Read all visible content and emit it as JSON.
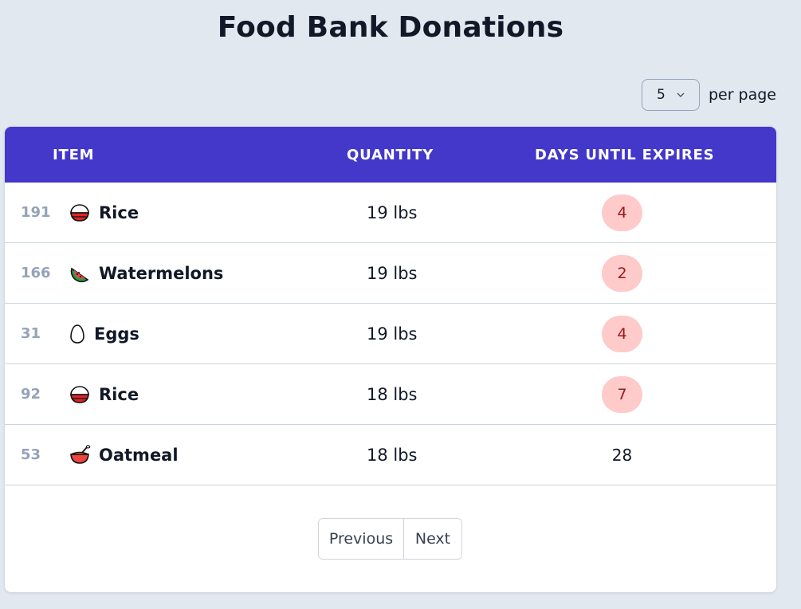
{
  "header": {
    "title": "Food Bank Donations"
  },
  "per_page": {
    "selected": "5",
    "label": "per page"
  },
  "table": {
    "columns": {
      "item": "ITEM",
      "quantity": "QUANTITY",
      "days": "DAYS UNTIL EXPIRES"
    },
    "rows": [
      {
        "id": "191",
        "icon": "rice-bowl-icon",
        "name": "Rice",
        "quantity": "19 lbs",
        "days": "4",
        "status": "urgent"
      },
      {
        "id": "166",
        "icon": "watermelon-icon",
        "name": "Watermelons",
        "quantity": "19 lbs",
        "days": "2",
        "status": "urgent"
      },
      {
        "id": "31",
        "icon": "egg-icon",
        "name": "Eggs",
        "quantity": "19 lbs",
        "days": "4",
        "status": "urgent"
      },
      {
        "id": "92",
        "icon": "rice-bowl-icon",
        "name": "Rice",
        "quantity": "18 lbs",
        "days": "7",
        "status": "urgent"
      },
      {
        "id": "53",
        "icon": "oatmeal-bowl-icon",
        "name": "Oatmeal",
        "quantity": "18 lbs",
        "days": "28",
        "status": "ok"
      }
    ]
  },
  "pagination": {
    "previous": "Previous",
    "next": "Next"
  },
  "colors": {
    "header_bg": "#4338ca",
    "page_bg": "#e2e8f0",
    "urgent_bg": "#fecaca",
    "urgent_text": "#991b1b"
  }
}
